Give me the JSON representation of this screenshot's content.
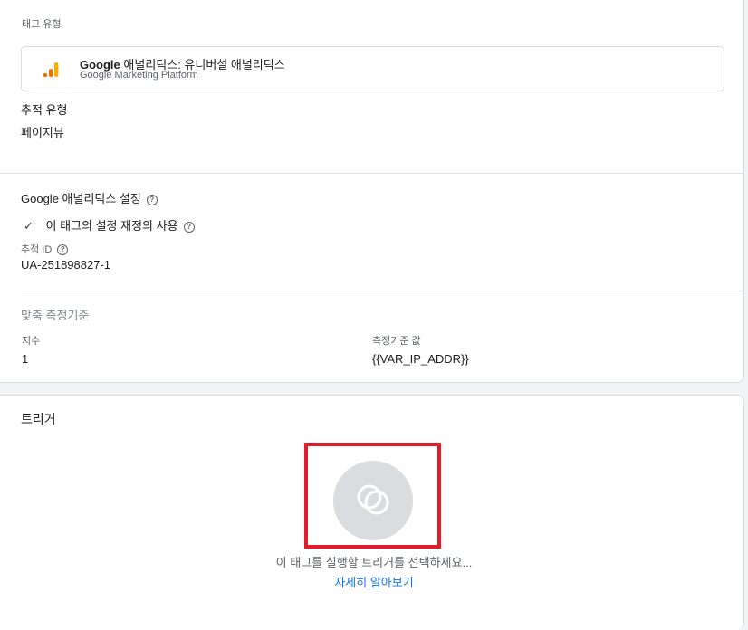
{
  "tag_type": {
    "label": "태그 유형",
    "name_bold": "Google",
    "name_rest": " 애널리틱스: 유니버설 애널리틱스",
    "provider": "Google Marketing Platform",
    "icon": "analytics-bar-icon"
  },
  "tracking_type": {
    "label": "추적 유형",
    "value": "페이지뷰"
  },
  "ga_settings": {
    "label": "Google 애널리틱스 설정",
    "override_check": "✓",
    "override_label": "이 태그의 설정 재정의 사용",
    "tracking_id_label": "추적 ID",
    "tracking_id": "UA-251898827-1"
  },
  "custom_metrics": {
    "label": "맞춤 측정기준",
    "index_header": "지수",
    "value_header": "측정기준 값",
    "rows": [
      {
        "index": "1",
        "value": "{{VAR_IP_ADDR}}"
      }
    ]
  },
  "triggers": {
    "label": "트리거",
    "empty_message": "이 태그를 실행할 트리거를 선택하세요...",
    "learn_more": "자세히 알아보기"
  },
  "colors": {
    "accent": "#1a73e8",
    "highlight_box": "#e21d29",
    "ga_orange": "#f9ab00",
    "ga_dark_orange": "#e37400"
  }
}
